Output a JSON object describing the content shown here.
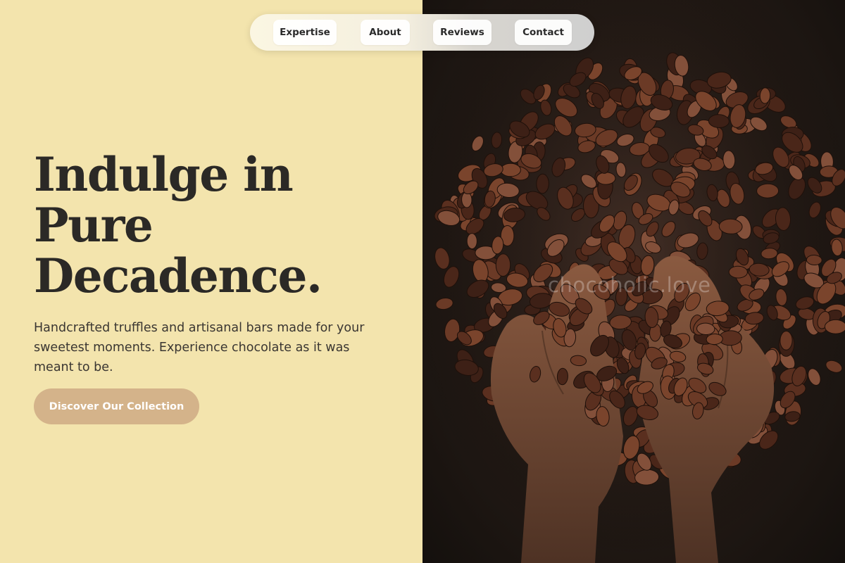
{
  "nav": {
    "items": [
      {
        "label": "Expertise"
      },
      {
        "label": "About"
      },
      {
        "label": "Reviews"
      },
      {
        "label": "Contact"
      }
    ]
  },
  "hero": {
    "title": "Indulge in Pure Decadence.",
    "subtitle": "Handcrafted truffles and artisanal bars made for your sweetest moments. Experience chocolate as it was meant to be.",
    "cta_label": "Discover Our Collection"
  },
  "image": {
    "watermark": "chocoholic.love",
    "subject": "hands-holding-cocoa-beans"
  },
  "colors": {
    "background_left": "#f3e4ad",
    "text_dark": "#2b2926",
    "cta_bg": "#d4b38a",
    "bean": "#6b3a26"
  }
}
